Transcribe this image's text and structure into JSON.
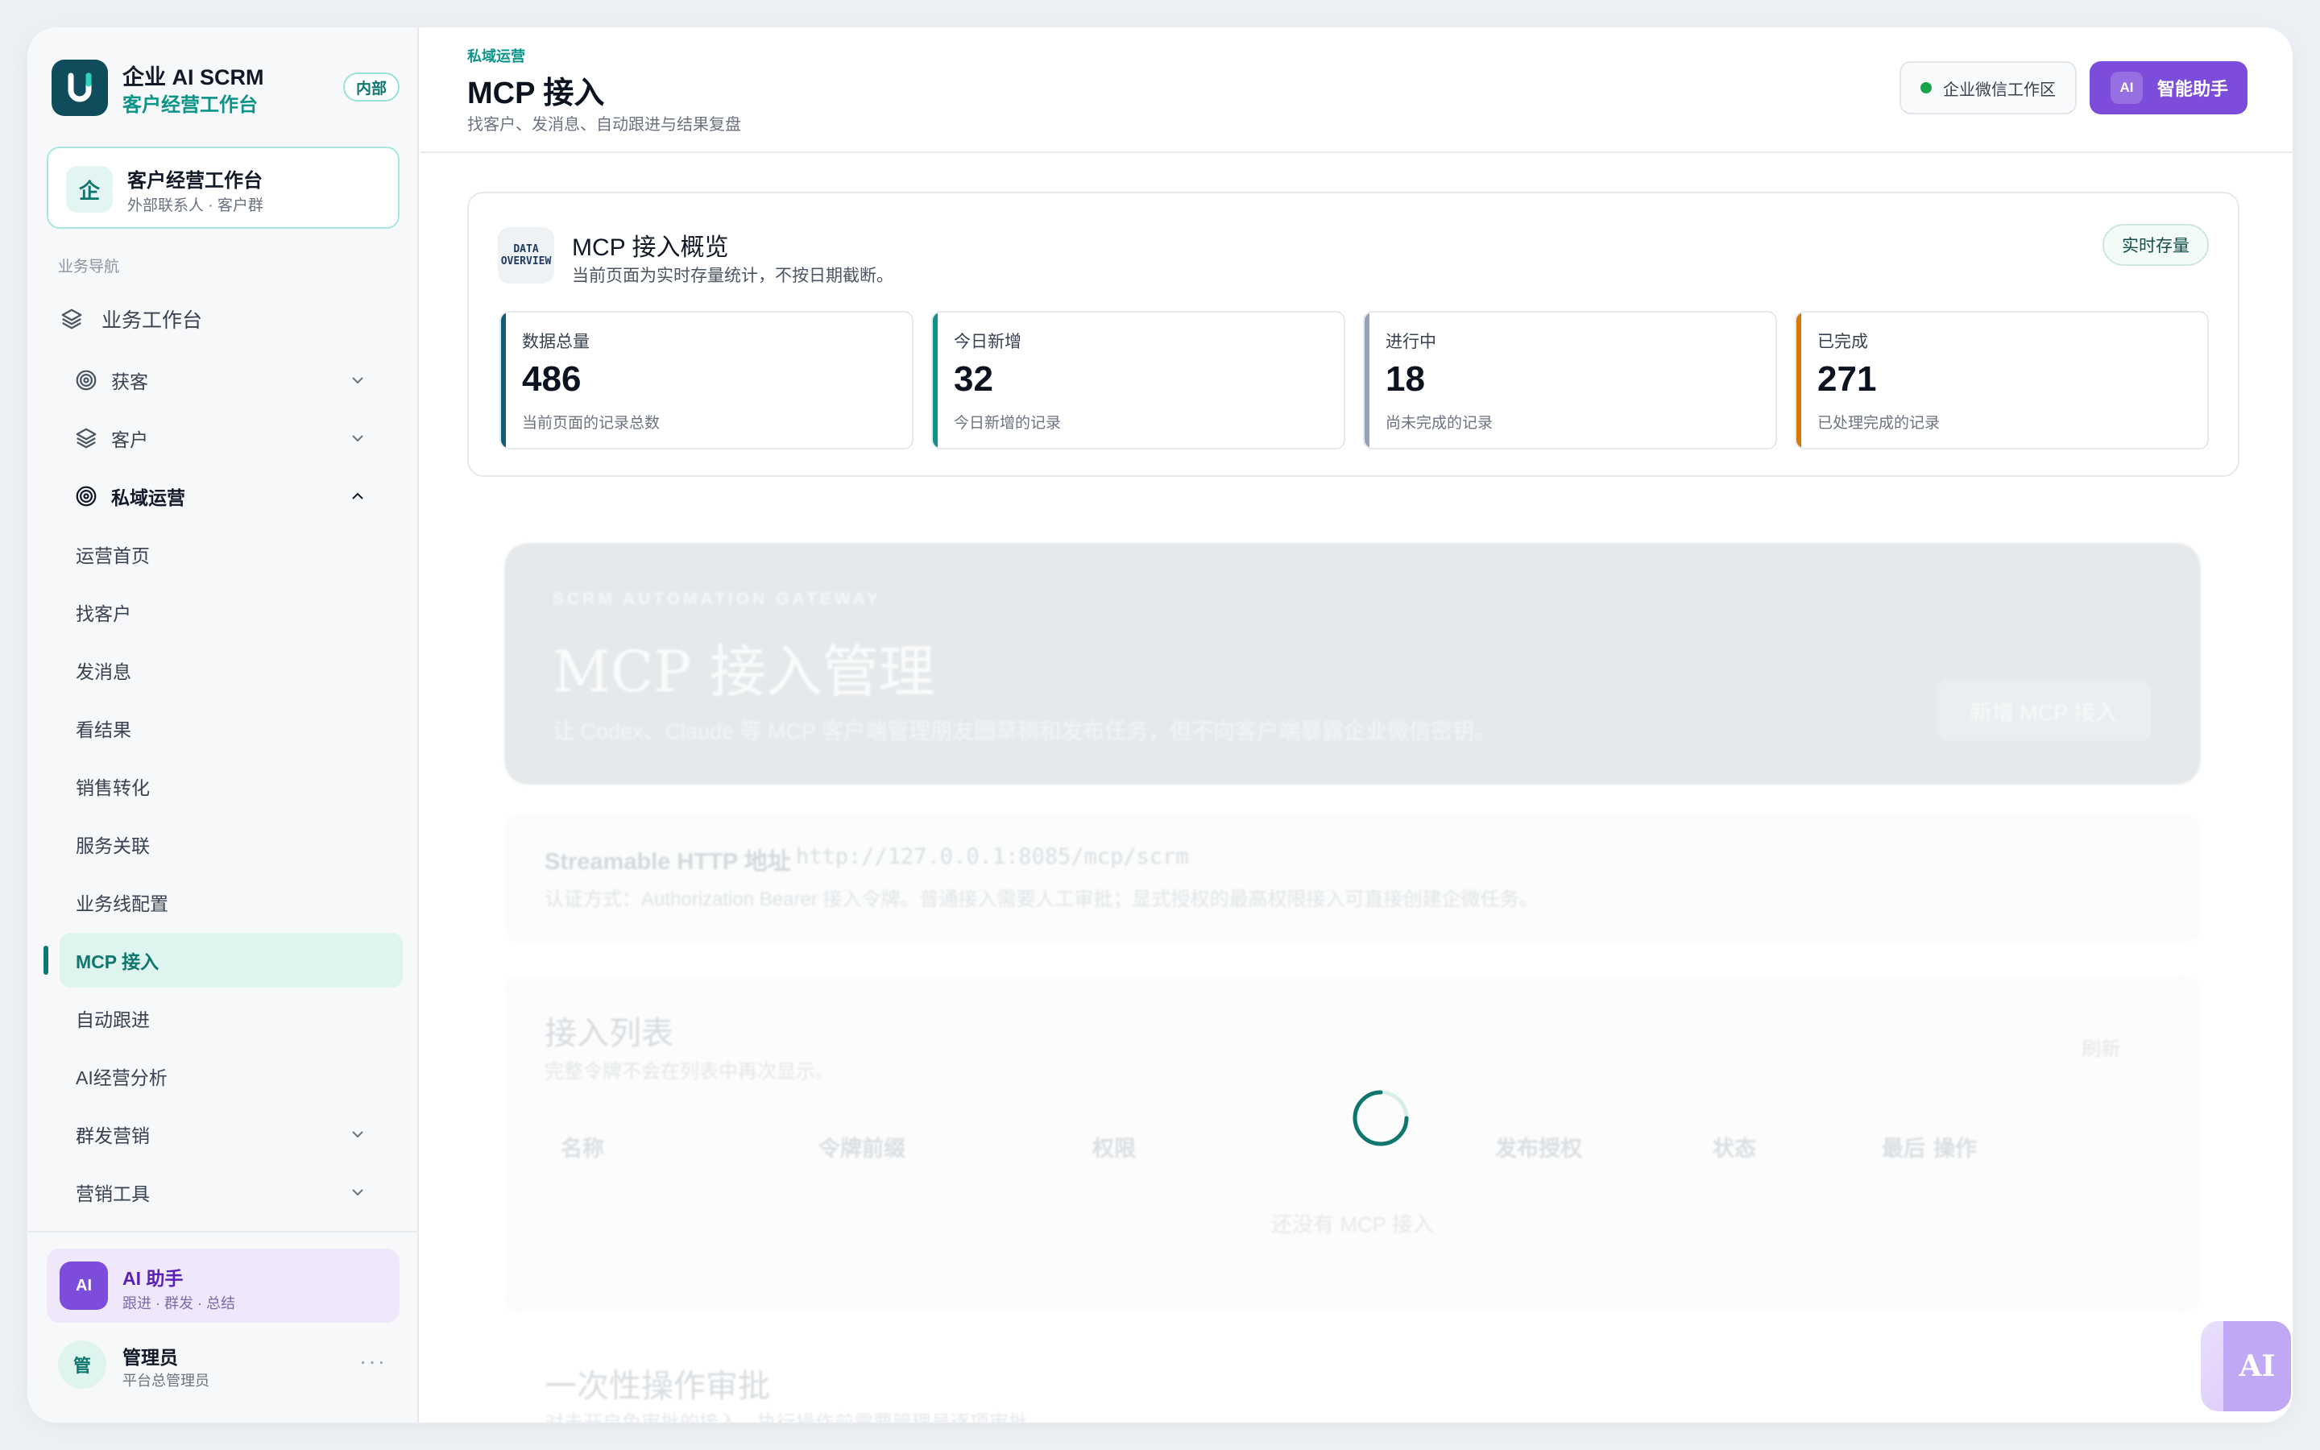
{
  "brand": {
    "title": "企业 AI SCRM",
    "subtitle": "客户经营工作台",
    "badge": "内部"
  },
  "workspace": {
    "icon_char": "企",
    "title": "客户经营工作台",
    "subtitle": "外部联系人 · 客户群"
  },
  "nav": {
    "section_label": "业务导航",
    "top": {
      "label": "业务工作台",
      "icon": "layers-icon"
    },
    "groups": [
      {
        "label": "获客",
        "icon": "target-icon",
        "expanded": false
      },
      {
        "label": "客户",
        "icon": "layers-icon",
        "expanded": false
      },
      {
        "label": "私域运营",
        "icon": "target-icon",
        "expanded": true
      }
    ],
    "items": [
      "运营首页",
      "找客户",
      "发消息",
      "看结果",
      "销售转化",
      "服务关联",
      "业务线配置",
      "MCP 接入",
      "自动跟进",
      "AI经营分析"
    ],
    "active_item": "MCP 接入",
    "groups_after": [
      {
        "label": "群发营销",
        "expanded": false
      },
      {
        "label": "营销工具",
        "expanded": false
      }
    ]
  },
  "ai_card": {
    "avatar": "AI",
    "title": "AI 助手",
    "subtitle": "跟进 · 群发 · 总结"
  },
  "user": {
    "avatar": "管",
    "name": "管理员",
    "role": "平台总管理员",
    "more": "···"
  },
  "header": {
    "breadcrumb": "私域运营",
    "title": "MCP 接入",
    "subtitle": "找客户、发消息、自动跟进与结果复盘",
    "wecom_label": "企业微信工作区",
    "ai_button": {
      "mini": "AI",
      "label": "智能助手"
    }
  },
  "overview": {
    "icon_lines": [
      "DATA",
      "OVERVIEW"
    ],
    "title": "MCP 接入概览",
    "subtitle": "当前页面为实时存量统计，不按日期截断。",
    "pill": "实时存量",
    "stats": [
      {
        "label": "数据总量",
        "value": "486",
        "desc": "当前页面的记录总数",
        "color": "#0f5e78"
      },
      {
        "label": "今日新增",
        "value": "32",
        "desc": "今日新增的记录",
        "color": "#0d9488"
      },
      {
        "label": "进行中",
        "value": "18",
        "desc": "尚未完成的记录",
        "color": "#94a3b8"
      },
      {
        "label": "已完成",
        "value": "271",
        "desc": "已处理完成的记录",
        "color": "#d97706"
      }
    ]
  },
  "hero": {
    "eyebrow": "SCRM AUTOMATION GATEWAY",
    "title": "MCP 接入管理",
    "desc": "让 Codex、Claude 等 MCP 客户端管理朋友圈草稿和发布任务，但不向客户端暴露企业微信密钥。",
    "button": "新增 MCP 接入"
  },
  "endpoint": {
    "label": "Streamable HTTP 地址",
    "url": "http://127.0.0.1:8085/mcp/scrm",
    "desc": "认证方式：Authorization Bearer 接入令牌。普通接入需要人工审批；显式授权的最高权限接入可直接创建企微任务。"
  },
  "list": {
    "title": "接入列表",
    "subtitle": "完整令牌不会在列表中再次显示。",
    "refresh": "刷新",
    "columns": [
      "名称",
      "令牌前缀",
      "权限",
      "发布授权",
      "状态",
      "最后",
      "操作"
    ],
    "empty": "还没有 MCP 接入"
  },
  "approval": {
    "title": "一次性操作审批",
    "subtitle": "对未开启免审批的接入，执行操作前需要管理员逐项审批"
  },
  "floating_ai": {
    "label": "AI"
  },
  "colors": {
    "accent": "#0d9488",
    "brand_dark": "#0f4c5c",
    "ai_purple": "#7c4ddb"
  }
}
